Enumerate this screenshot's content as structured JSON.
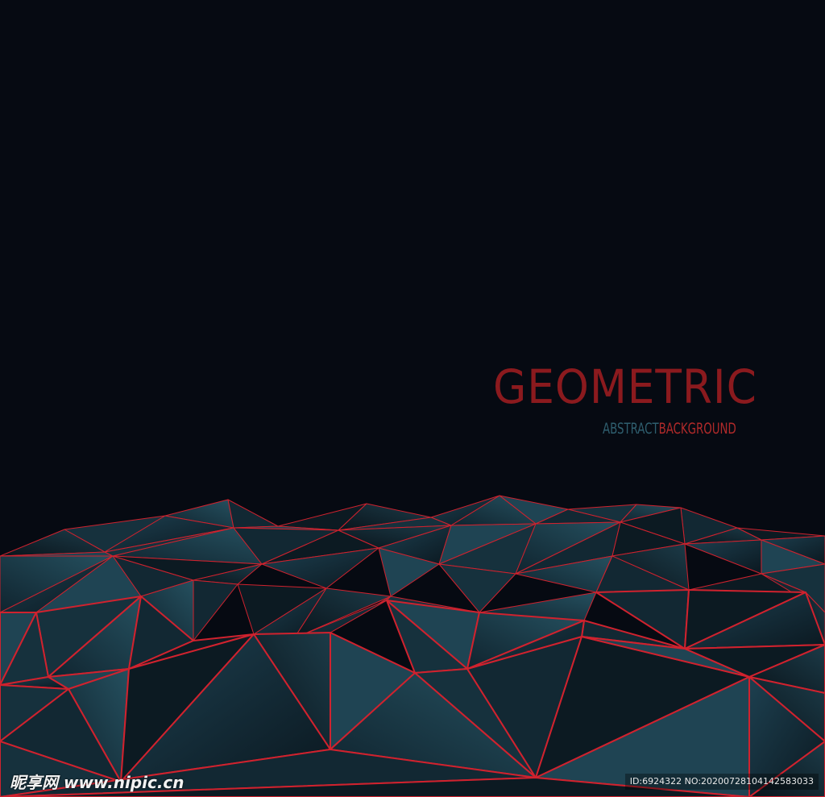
{
  "title": "GEOMETRIC",
  "subtitle": {
    "part1": "ABSTRACT",
    "part2": "BACKGROUND"
  },
  "watermark": {
    "logo": "昵享网 www.nipic.cn",
    "id_text": "ID:6924322 NO:20200728104142583033"
  },
  "colors": {
    "background": "#060a12",
    "title": "#8b1a1e",
    "subtitle_abstract": "#2f5f6f",
    "subtitle_background": "#b02a2a",
    "terrain_fill": "#17323f",
    "terrain_edges": "#d0222e"
  }
}
